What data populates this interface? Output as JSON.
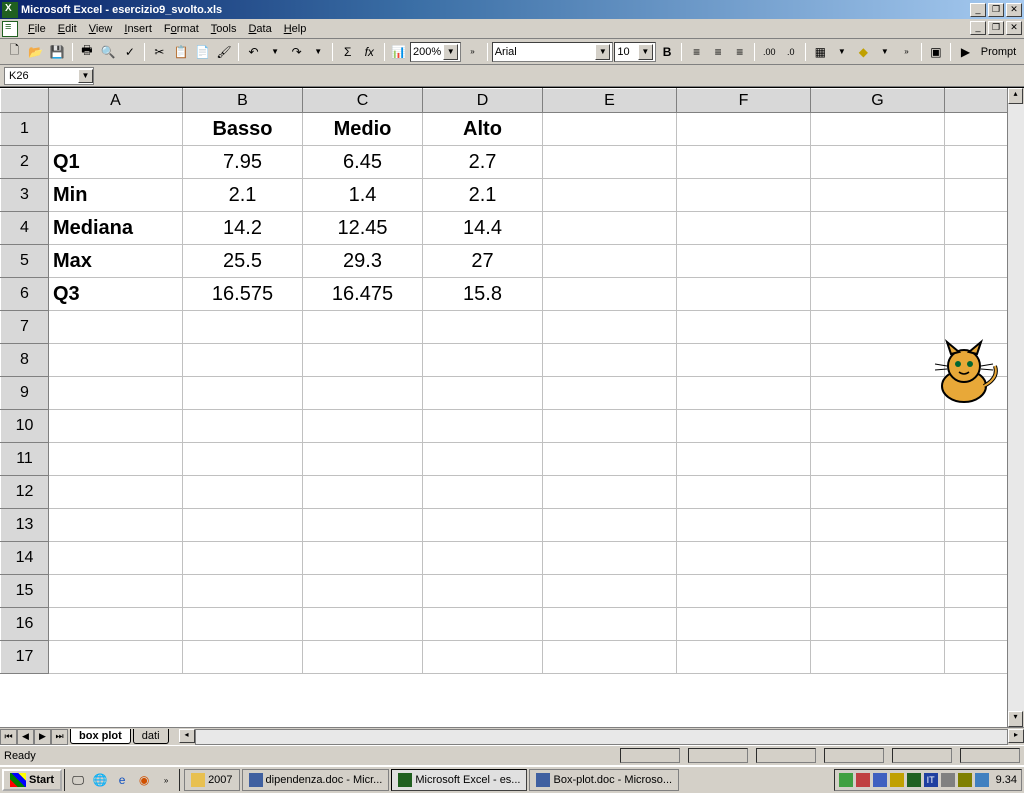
{
  "app": {
    "title": "Microsoft Excel - esercizio9_svolto.xls"
  },
  "menu": {
    "file": "File",
    "edit": "Edit",
    "view": "View",
    "insert": "Insert",
    "format": "Format",
    "tools": "Tools",
    "data": "Data",
    "help": "Help"
  },
  "toolbar": {
    "zoom": "200%",
    "font": "Arial",
    "size": "10",
    "prompt": "Prompt"
  },
  "namebox": {
    "ref": "K26"
  },
  "columns": [
    "A",
    "B",
    "C",
    "D",
    "E",
    "F",
    "G"
  ],
  "rows": [
    "1",
    "2",
    "3",
    "4",
    "5",
    "6",
    "7",
    "8",
    "9",
    "10",
    "11",
    "12",
    "13",
    "14",
    "15",
    "16",
    "17"
  ],
  "cells": {
    "B1": "Basso",
    "C1": "Medio",
    "D1": "Alto",
    "A2": "Q1",
    "B2": "7.95",
    "C2": "6.45",
    "D2": "2.7",
    "A3": "Min",
    "B3": "2.1",
    "C3": "1.4",
    "D3": "2.1",
    "A4": "Mediana",
    "B4": "14.2",
    "C4": "12.45",
    "D4": "14.4",
    "A5": "Max",
    "B5": "25.5",
    "C5": "29.3",
    "D5": "27",
    "A6": "Q3",
    "B6": "16.575",
    "C6": "16.475",
    "D6": "15.8"
  },
  "sheets": {
    "active": "box plot",
    "other": "dati"
  },
  "status": {
    "ready": "Ready"
  },
  "taskbar": {
    "start": "Start",
    "quick_folder": "2007",
    "task1": "dipendenza.doc - Micr...",
    "task2": "Microsoft Excel - es...",
    "task3": "Box-plot.doc - Microso...",
    "clock": "9.34"
  },
  "chart_data": {
    "type": "table",
    "title": "Box-plot statistics",
    "columns": [
      "",
      "Basso",
      "Medio",
      "Alto"
    ],
    "rows": [
      {
        "label": "Q1",
        "Basso": 7.95,
        "Medio": 6.45,
        "Alto": 2.7
      },
      {
        "label": "Min",
        "Basso": 2.1,
        "Medio": 1.4,
        "Alto": 2.1
      },
      {
        "label": "Mediana",
        "Basso": 14.2,
        "Medio": 12.45,
        "Alto": 14.4
      },
      {
        "label": "Max",
        "Basso": 25.5,
        "Medio": 29.3,
        "Alto": 27
      },
      {
        "label": "Q3",
        "Basso": 16.575,
        "Medio": 16.475,
        "Alto": 15.8
      }
    ]
  }
}
